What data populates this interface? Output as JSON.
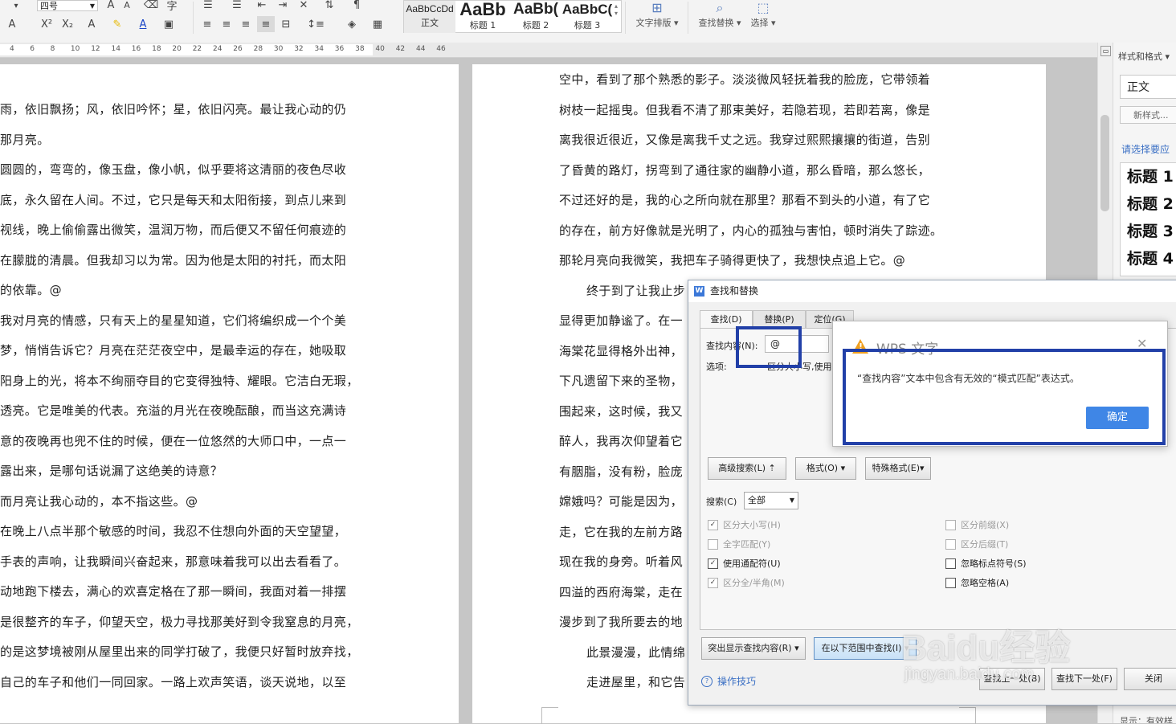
{
  "toolbar": {
    "font_size": "四号",
    "styles": [
      {
        "sample": "AaBbCcDd",
        "name": "正文"
      },
      {
        "sample": "AaBb",
        "name": "标题 1"
      },
      {
        "sample": "AaBb(",
        "name": "标题 2"
      },
      {
        "sample": "AaBbC(",
        "name": "标题 3"
      }
    ],
    "text_layout_label": "文字排版",
    "find_replace_label": "查找替换",
    "select_label": "选择"
  },
  "ruler": {
    "ticks": [
      "4",
      "6",
      "8",
      "10",
      "12",
      "14",
      "16",
      "18",
      "20",
      "22",
      "24",
      "26",
      "28",
      "30",
      "32",
      "34",
      "36",
      "38",
      "40",
      "42",
      "44",
      "46"
    ]
  },
  "page_left": {
    "lines": [
      "雨，依旧飘扬；风，依旧吟怀；星，依旧闪亮。最让我心动的仍",
      "那月亮。",
      "圆圆的，弯弯的，像玉盘，像小帆，似乎要将这清丽的夜色尽收",
      "底，永久留在人间。不过，它只是每天和太阳衔接，到点儿来到",
      "视线，晚上偷偷露出微笑，温润万物，而后便又不留任何痕迹的",
      "在朦胧的清晨。但我却习以为常。因为他是太阳的衬托，而太阳",
      "的依靠。@",
      "我对月亮的情感，只有天上的星星知道，它们将编织成一个个美",
      "梦，悄悄告诉它？月亮在茫茫夜空中，是最幸运的存在，她吸取",
      "阳身上的光，将本不绚丽夺目的它变得独特、耀眼。它洁白无瑕，",
      "透亮。它是唯美的代表。充溢的月光在夜晚酝酿，而当这充满诗",
      "意的夜晚再也兜不住的时候，便在一位悠然的大师口中，一点一",
      "露出来，是哪句话说漏了这绝美的诗意？",
      "而月亮让我心动的，本不指这些。@",
      "在晚上八点半那个敏感的时间，我忍不住想向外面的天空望望，",
      "手表的声响，让我瞬间兴奋起来，那意味着我可以出去看看了。",
      "动地跑下楼去，满心的欢喜定格在了那一瞬间，我面对着一排摆",
      "是很整齐的车子，仰望天空，极力寻找那美好到令我窒息的月亮，",
      "的是这梦境被刚从屋里出来的同学打破了，我便只好暂时放弃找，",
      "自己的车子和他们一同回家。一路上欢声笑语，谈天说地，以至"
    ]
  },
  "page_right": {
    "lines": [
      "空中，看到了那个熟悉的影子。淡淡微风轻抚着我的脸庞，它带领着",
      "树枝一起摇曳。但我看不清了那束美好，若隐若现，若即若离，像是",
      "离我很近很近，又像是离我千丈之远。我穿过熙熙攘攘的街道，告别",
      "了昏黄的路灯，拐弯到了通往家的幽静小道，那么昏暗，那么悠长，",
      "不过还好的是，我的心之所向就在那里？那看不到头的小道，有了它",
      "的存在，前方好像就是光明了，内心的孤独与害怕，顿时消失了踪迹。",
      "那轮月亮向我微笑，我把车子骑得更快了，我想快点追上它。@",
      "终于到了让我止步",
      "显得更加静谧了。在一",
      "海棠花显得格外出神，",
      "下凡遗留下来的圣物，",
      "围起来，这时候，我又",
      "醉人，我再次仰望着它",
      "有胭脂，没有粉，脸庞",
      "嫦娥吗？可能是因为，",
      "走，它在我的左前方路",
      "现在我的身旁。听着风",
      "四溢的西府海棠，走在",
      "漫步到了我所要去的地",
      "此景漫漫，此情绵",
      "走进屋里，和它告"
    ]
  },
  "styles_pane": {
    "title": "样式和格式 ▾",
    "current_style": "正文",
    "new_style_button": "新样式...",
    "hint": "请选择要应",
    "list": [
      "标题 1",
      "标题 2",
      "标题 3",
      "标题 4"
    ],
    "footer": "显示：有效样"
  },
  "find_dialog": {
    "title": "查找和替换",
    "tabs": [
      "查找(D)",
      "替换(P)",
      "定位(G)"
    ],
    "find_label": "查找内容(N):",
    "find_value": "@",
    "options_label": "选项:",
    "options_value": "区分大小写,使用",
    "advanced_button": "高级搜索(L) ⇡",
    "format_button": "格式(O)",
    "special_button": "特殊格式(E)",
    "search_label": "搜索(C)",
    "search_value": "全部",
    "checkboxes_left": [
      {
        "label": "区分大小写(H)",
        "checked": true,
        "enabled": false
      },
      {
        "label": "全字匹配(Y)",
        "checked": false,
        "enabled": false
      },
      {
        "label": "使用通配符(U)",
        "checked": true,
        "enabled": true
      },
      {
        "label": "区分全/半角(M)",
        "checked": true,
        "enabled": false
      }
    ],
    "checkboxes_right": [
      {
        "label": "区分前缀(X)",
        "checked": false,
        "enabled": false
      },
      {
        "label": "区分后缀(T)",
        "checked": false,
        "enabled": false
      },
      {
        "label": "忽略标点符号(S)",
        "checked": false,
        "enabled": true
      },
      {
        "label": "忽略空格(A)",
        "checked": false,
        "enabled": true
      }
    ],
    "highlight_button": "突出显示查找内容(R)",
    "find_in_button": "在以下范围中查找(I)",
    "prev_button": "查找上一处(B)",
    "next_button": "查找下一处(F)",
    "close_button": "关闭",
    "tips_link": "操作技巧"
  },
  "alert": {
    "title": "WPS 文字",
    "message": "“查找内容”文本中包含有无效的“模式匹配”表达式。",
    "ok_button": "确定"
  },
  "watermark": {
    "text": "Baidu经验",
    "sub": "jingyan.baidu.com"
  },
  "colors": {
    "highlight_frame": "#2240a8",
    "ok_blue": "#3f86e6",
    "link_blue": "#3a6fc4",
    "warning": "#f0a020"
  }
}
